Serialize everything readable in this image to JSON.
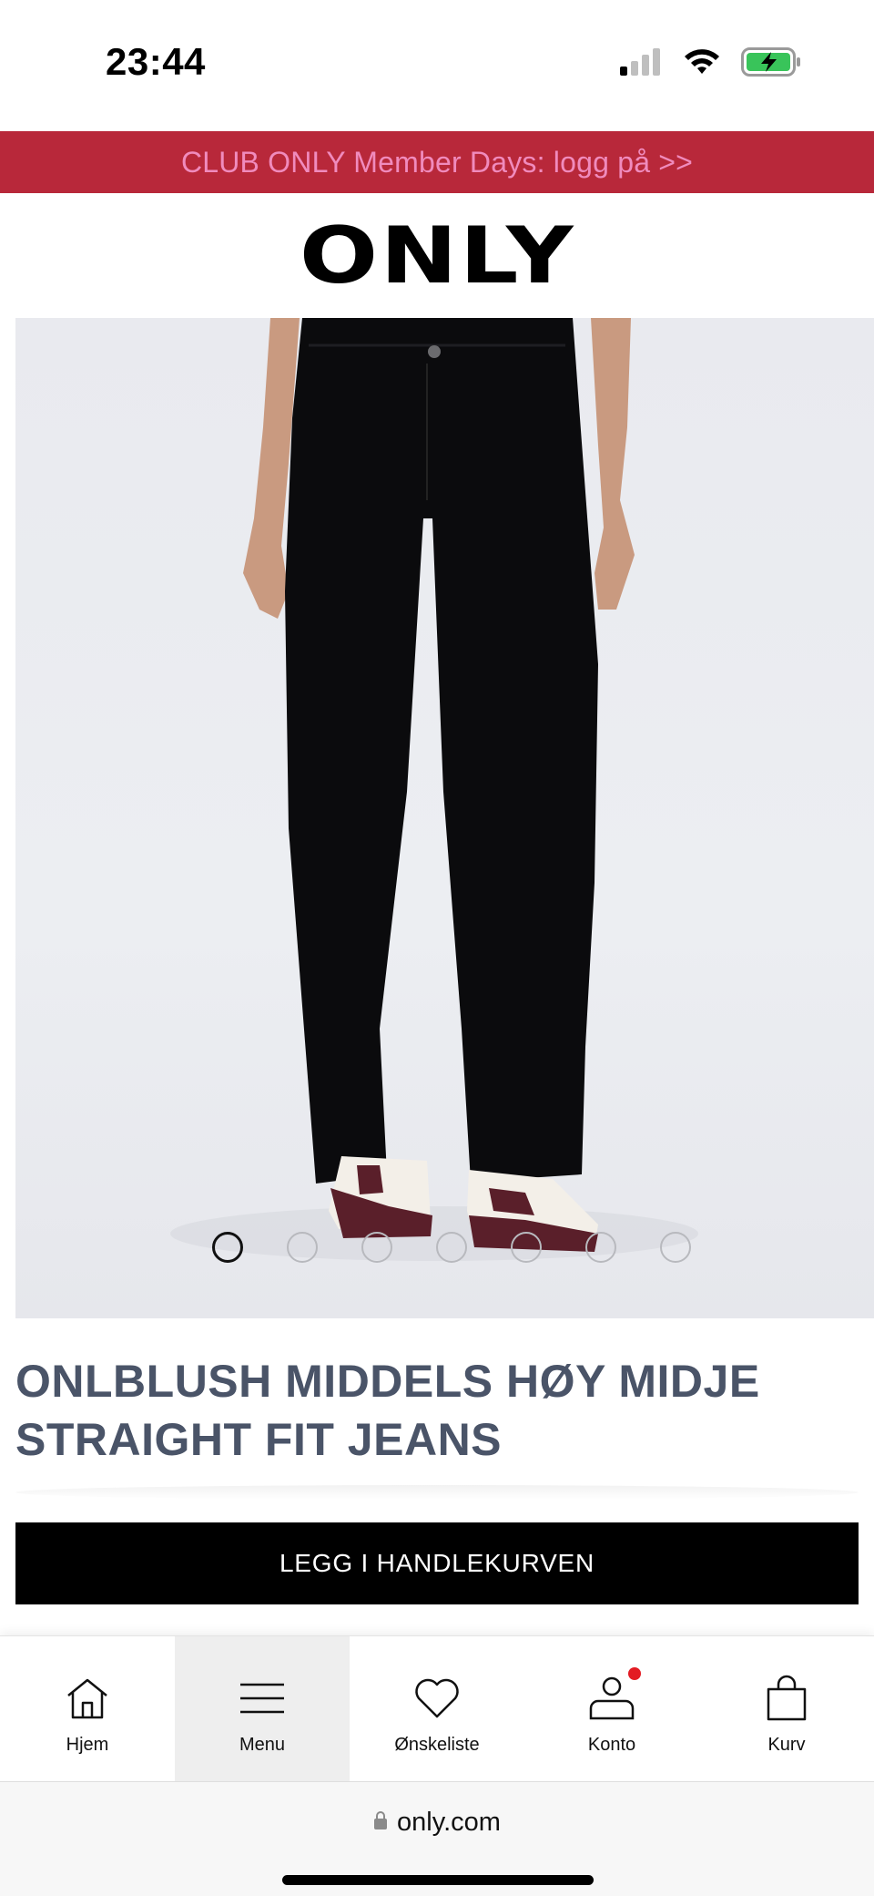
{
  "status_bar": {
    "time": "23:44",
    "icons": [
      "cellular-signal-icon",
      "wifi-icon",
      "battery-charging-icon"
    ]
  },
  "promo_banner": {
    "text": "CLUB ONLY Member Days: logg på >>",
    "bg_color": "#b8283a",
    "text_color": "#f08bbd"
  },
  "header": {
    "logo": "ONLY"
  },
  "product": {
    "image_icon": "product-photo-black-jeans",
    "carousel": {
      "total": 7,
      "active": 1
    },
    "title": "ONLBLUSH MIDDELS HØY MIDJE STRAIGHT FIT JEANS",
    "add_to_cart_label": "LEGG I HANDLEKURVEN",
    "title_color": "#4a5468"
  },
  "bottom_nav": {
    "items": [
      {
        "label": "Hjem",
        "icon": "home-icon"
      },
      {
        "label": "Menu",
        "icon": "hamburger-menu-icon",
        "active": true
      },
      {
        "label": "Ønskeliste",
        "icon": "heart-icon"
      },
      {
        "label": "Konto",
        "icon": "account-icon",
        "badge": true
      },
      {
        "label": "Kurv",
        "icon": "shopping-bag-icon"
      }
    ]
  },
  "browser": {
    "url": "only.com",
    "lock_icon": "lock-icon"
  }
}
